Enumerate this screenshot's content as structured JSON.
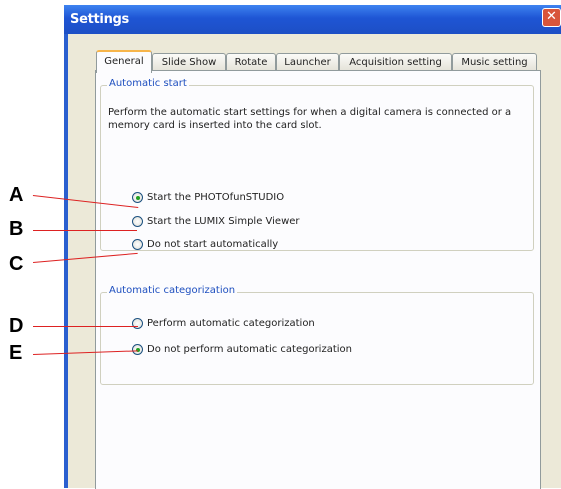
{
  "window": {
    "title": "Settings",
    "close_symbol": "✕"
  },
  "tabs": [
    {
      "label": "General",
      "active": true
    },
    {
      "label": "Slide Show",
      "active": false
    },
    {
      "label": "Rotate",
      "active": false
    },
    {
      "label": "Launcher",
      "active": false
    },
    {
      "label": "Acquisition setting",
      "active": false
    },
    {
      "label": "Music setting",
      "active": false
    }
  ],
  "automatic_start": {
    "legend": "Automatic start",
    "description": "Perform the automatic start settings for when a digital camera is connected or a memory card is inserted into the card slot.",
    "options": [
      {
        "label": "Start the PHOTOfunSTUDIO",
        "selected": true
      },
      {
        "label": "Start the LUMIX Simple Viewer",
        "selected": false
      },
      {
        "label": "Do not start automatically",
        "selected": false
      }
    ]
  },
  "automatic_categorization": {
    "legend": "Automatic categorization",
    "options": [
      {
        "label": "Perform automatic categorization",
        "selected": false
      },
      {
        "label": "Do not perform automatic categorization",
        "selected": true
      }
    ]
  },
  "callouts": [
    "A",
    "B",
    "C",
    "D",
    "E"
  ],
  "colors": {
    "titlebar": "#1e55d4",
    "callout_line": "#dd2222",
    "legend_text": "#1e4fbf",
    "active_tab_highlight": "#f7b54a"
  }
}
